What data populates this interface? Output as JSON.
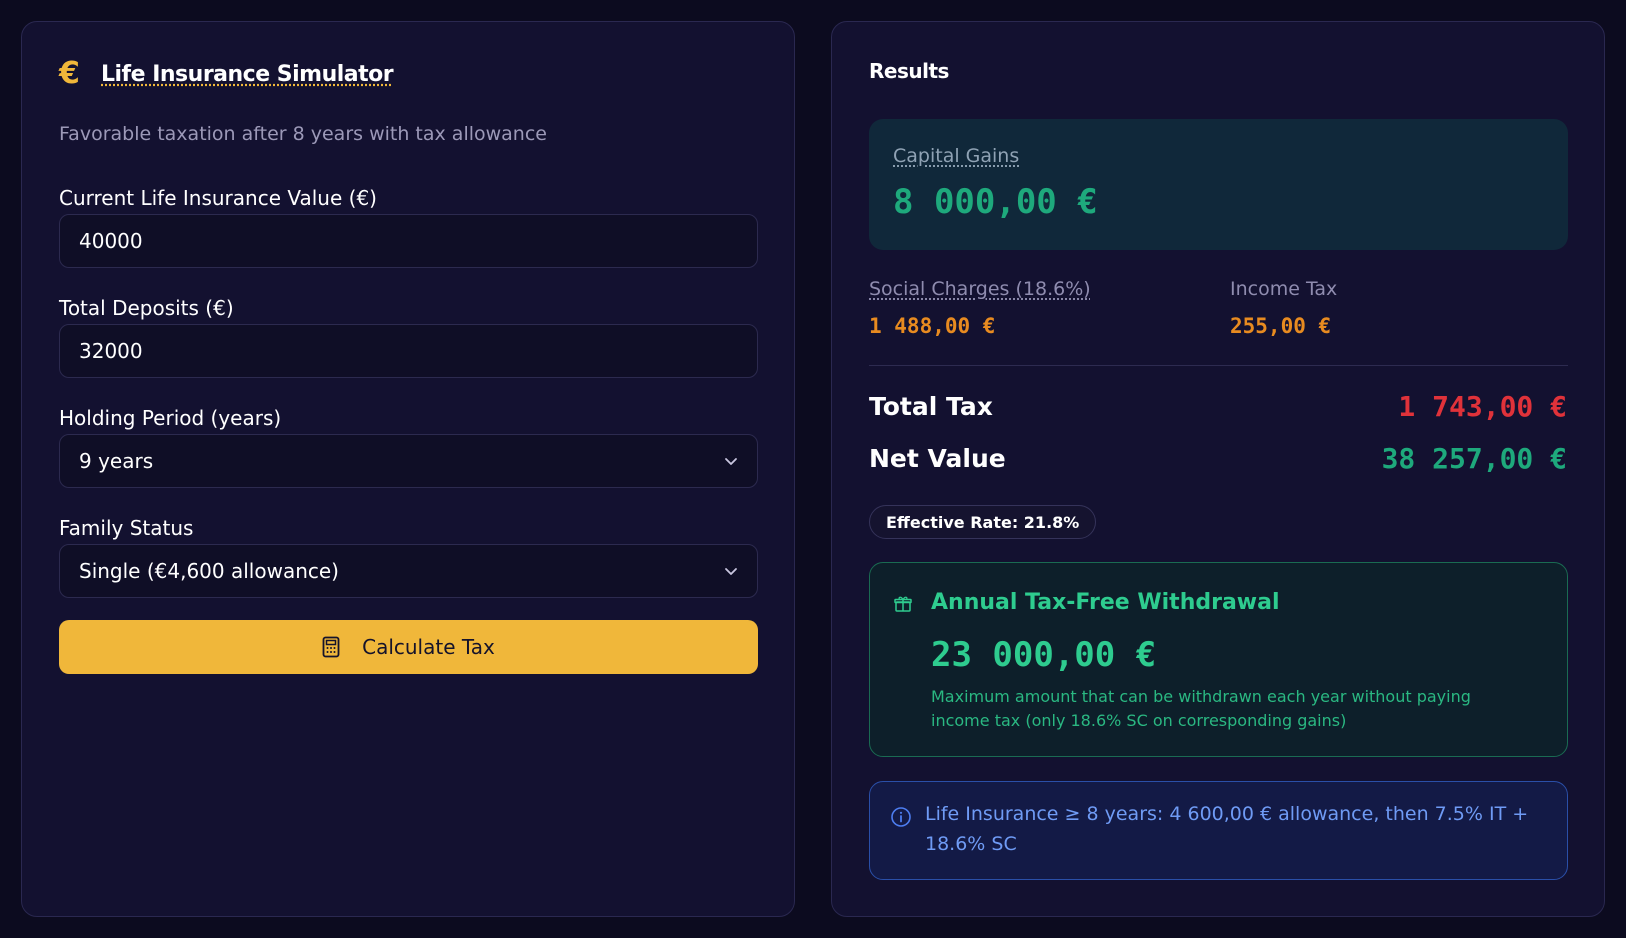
{
  "left": {
    "title": "Life Insurance Simulator",
    "subtitle": "Favorable taxation after 8 years with tax allowance",
    "fields": [
      {
        "label": "Current Life Insurance Value (€)",
        "value": "40000"
      },
      {
        "label": "Total Deposits (€)",
        "value": "32000"
      },
      {
        "label": "Holding Period (years)",
        "value": "9 years"
      },
      {
        "label": "Family Status",
        "value": "Single (€4,600 allowance)"
      }
    ],
    "button_label": "Calculate Tax"
  },
  "right": {
    "title": "Results",
    "capital_gains": {
      "label": "Capital Gains",
      "value": "8 000,00 €"
    },
    "social_charges": {
      "label": "Social Charges (18.6%)",
      "value": "1 488,00 €"
    },
    "income_tax": {
      "label": "Income Tax",
      "value": "255,00 €"
    },
    "total_tax": {
      "label": "Total Tax",
      "value": "1 743,00 €"
    },
    "net_value": {
      "label": "Net Value",
      "value": "38 257,00 €"
    },
    "effective_rate": "Effective Rate: 21.8%",
    "tax_free": {
      "title": "Annual Tax-Free Withdrawal",
      "value": "23 000,00 €",
      "description": "Maximum amount that can be withdrawn each year without paying income tax (only 18.6% SC on corresponding gains)"
    },
    "info": "Life Insurance ≥ 8 years: 4 600,00 € allowance, then 7.5% IT + 18.6% SC"
  },
  "colors": {
    "accent": "#f0b73a",
    "gain_green": "#1ea97c",
    "tax_orange": "#e88b20",
    "total_red": "#e0323a",
    "info_blue": "#6f9bf5"
  }
}
